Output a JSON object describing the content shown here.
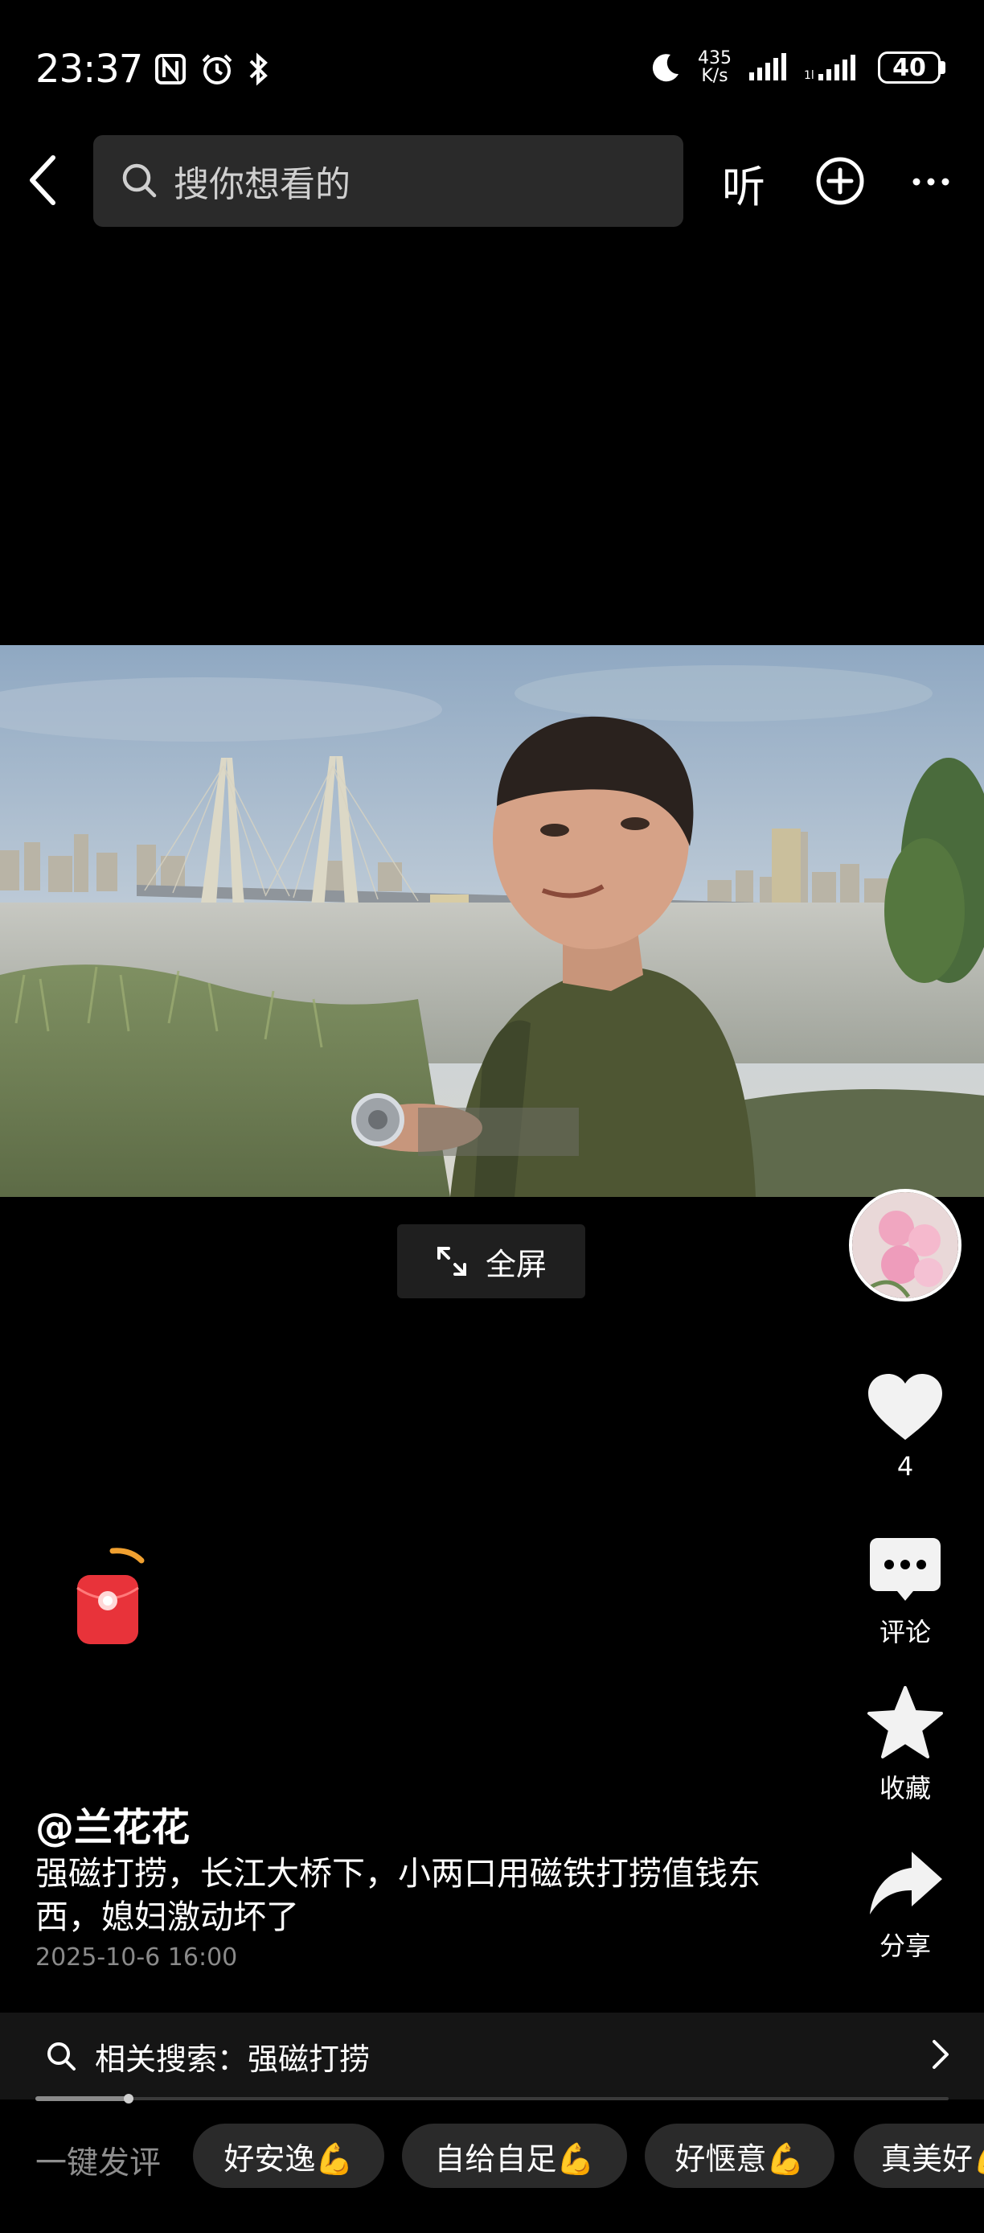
{
  "status_bar": {
    "time": "23:37",
    "left_icons": [
      "nfc-icon",
      "alarm-icon",
      "bluetooth-icon"
    ],
    "net_speed_value": "435",
    "net_speed_unit": "K/s",
    "battery": "40"
  },
  "top_bar": {
    "search_placeholder": "搜你想看的",
    "listen_label": "听"
  },
  "video": {
    "fullscreen_label": "全屏"
  },
  "actions": {
    "like_count": "4",
    "comment_label": "评论",
    "favorite_label": "收藏",
    "share_label": "分享"
  },
  "post": {
    "author": "@兰花花",
    "description": "强磁打捞，长江大桥下，小两口用磁铁打捞值钱东西，媳妇激动坏了",
    "date": "2025-10-6 16:00"
  },
  "related_search": {
    "text": "相关搜索：强磁打捞"
  },
  "progress": {
    "fraction": 0.06
  },
  "quick_comments": {
    "label": "一键发评",
    "chips": [
      "好安逸💪",
      "自给自足💪",
      "好惬意💪",
      "真美好💪"
    ]
  },
  "colors": {
    "background": "#000000",
    "search_bg": "#2a2a2a",
    "chip_bg": "#2a2a2a",
    "redpack": "#e8333a"
  }
}
